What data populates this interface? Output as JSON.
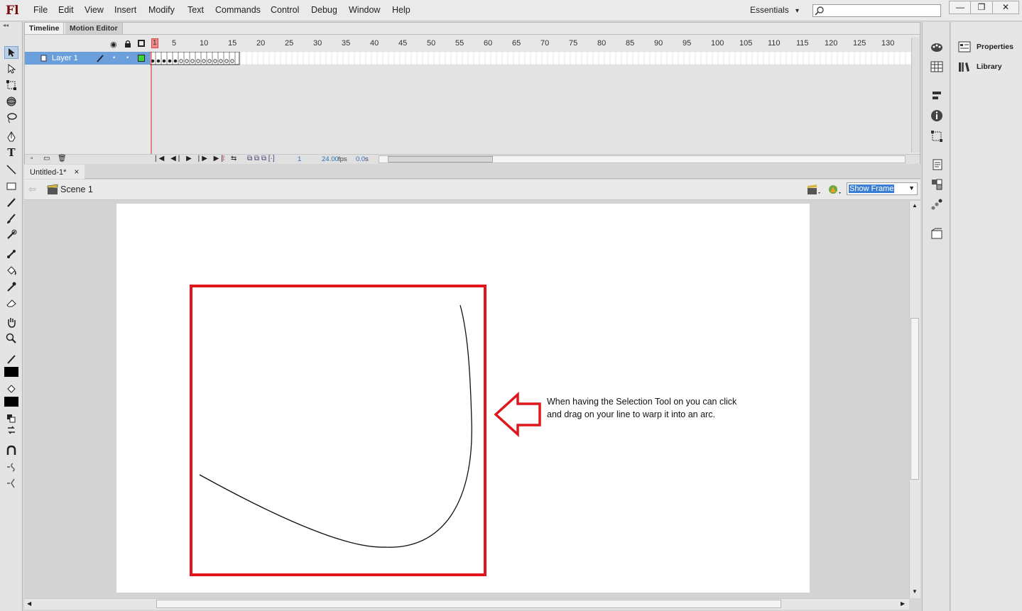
{
  "app": {
    "logo": "Fl"
  },
  "menu": [
    "File",
    "Edit",
    "View",
    "Insert",
    "Modify",
    "Text",
    "Commands",
    "Control",
    "Debug",
    "Window",
    "Help"
  ],
  "workspace": {
    "label": "Essentials",
    "caret": "▾"
  },
  "window_controls": {
    "minimize": "—",
    "restore": "❐",
    "close": "✕"
  },
  "timeline": {
    "tabs": [
      "Timeline",
      "Motion Editor"
    ],
    "ruler": [
      "1",
      "5",
      "10",
      "15",
      "20",
      "25",
      "30",
      "35",
      "40",
      "45",
      "50",
      "55",
      "60",
      "65",
      "70",
      "75",
      "80",
      "85",
      "90",
      "95",
      "100",
      "105",
      "110",
      "115",
      "120",
      "125",
      "130"
    ],
    "layer_name": "Layer 1",
    "current_frame": "1",
    "fps": "24.00",
    "fps_unit": "fps",
    "time": "0.0",
    "time_unit": "s"
  },
  "document": {
    "tab_title": "Untitled-1*",
    "close": "×"
  },
  "scene": {
    "name": "Scene 1",
    "zoom_select": "Show Frame"
  },
  "annotation": {
    "text": "When having the Selection Tool on you can click and drag on your line to warp it into an arc.",
    "box_color": "#e0161c",
    "arrow_color": "#e0161c"
  },
  "right_panels": {
    "properties": "Properties",
    "library": "Library"
  }
}
